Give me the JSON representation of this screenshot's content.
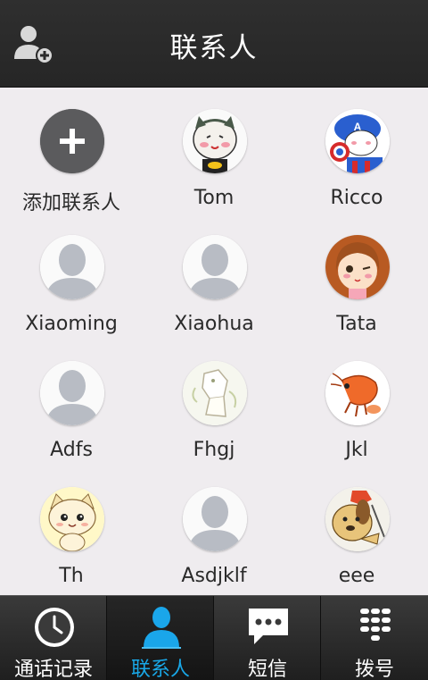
{
  "header": {
    "title": "联系人",
    "add_icon": "add-contact-icon"
  },
  "grid": {
    "cells": [
      {
        "name": "添加联系人",
        "avatar": "add-circle"
      },
      {
        "name": "Tom",
        "avatar": "cartoon-batman-cat"
      },
      {
        "name": "Ricco",
        "avatar": "cartoon-captain-cat"
      },
      {
        "name": "Xiaoming",
        "avatar": "default-silhouette"
      },
      {
        "name": "Xiaohua",
        "avatar": "default-silhouette"
      },
      {
        "name": "Tata",
        "avatar": "cartoon-girl"
      },
      {
        "name": "Adfs",
        "avatar": "default-silhouette"
      },
      {
        "name": "Fhgj",
        "avatar": "cartoon-sketch"
      },
      {
        "name": "Jkl",
        "avatar": "cartoon-shrimp"
      },
      {
        "name": "Th",
        "avatar": "cartoon-kitten"
      },
      {
        "name": "Asdjklf",
        "avatar": "default-silhouette"
      },
      {
        "name": "eee",
        "avatar": "cartoon-dog"
      }
    ]
  },
  "tabs": [
    {
      "label": "通话记录",
      "icon": "clock-icon",
      "active": false
    },
    {
      "label": "联系人",
      "icon": "contact-person-icon",
      "active": true
    },
    {
      "label": "短信",
      "icon": "message-bubble-icon",
      "active": false
    },
    {
      "label": "拨号",
      "icon": "dialpad-icon",
      "active": false
    }
  ],
  "colors": {
    "active_tab": "#19a8e8",
    "header_bg": "#2a2a2a",
    "grid_bg": "#efecef"
  }
}
